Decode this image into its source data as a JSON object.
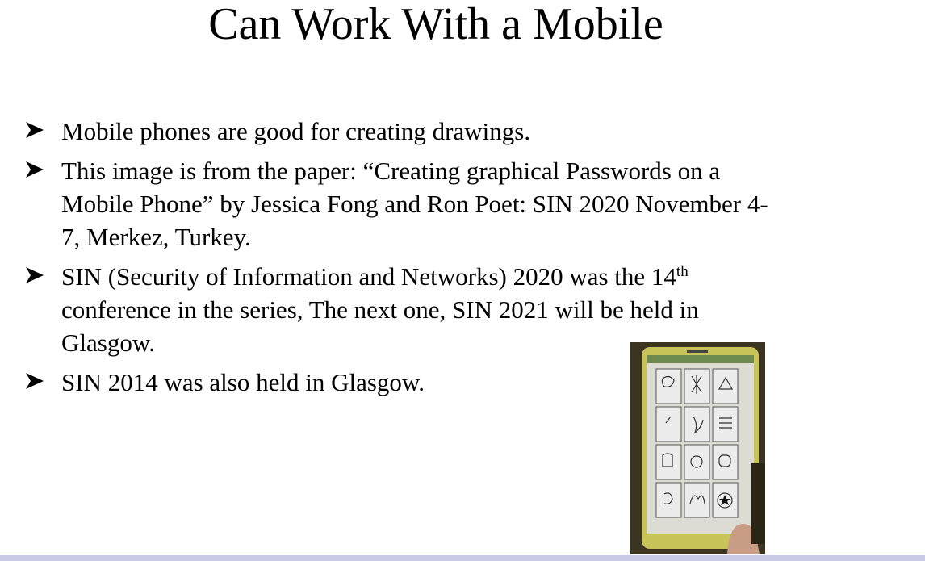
{
  "slide": {
    "title": "Can Work With a Mobile",
    "bullets": [
      {
        "lines": [
          "Mobile phones are good for creating drawings."
        ]
      },
      {
        "lines": [
          "This image is from the paper: “Creating graphical Passwords on a",
          "Mobile Phone” by Jessica Fong and Ron Poet: SIN 2020 November 4-",
          "7, Merkez, Turkey."
        ]
      },
      {
        "line1_text": "SIN (Security of Information and Networks) 2020 was the 14",
        "line1_sup": "th",
        "lines": [
          "conference in the series,  The next one, SIN 2021 will be held in",
          "Glasgow."
        ]
      },
      {
        "lines": [
          "SIN 2014 was also held in Glasgow."
        ]
      }
    ],
    "bullet_icon": "arrowhead-bullet-icon",
    "image": {
      "subject": "phone-drawing-grid-photo"
    }
  },
  "colors": {
    "bottom_bar": "#c9cbe6",
    "phone_frame": "#c8c45a"
  }
}
